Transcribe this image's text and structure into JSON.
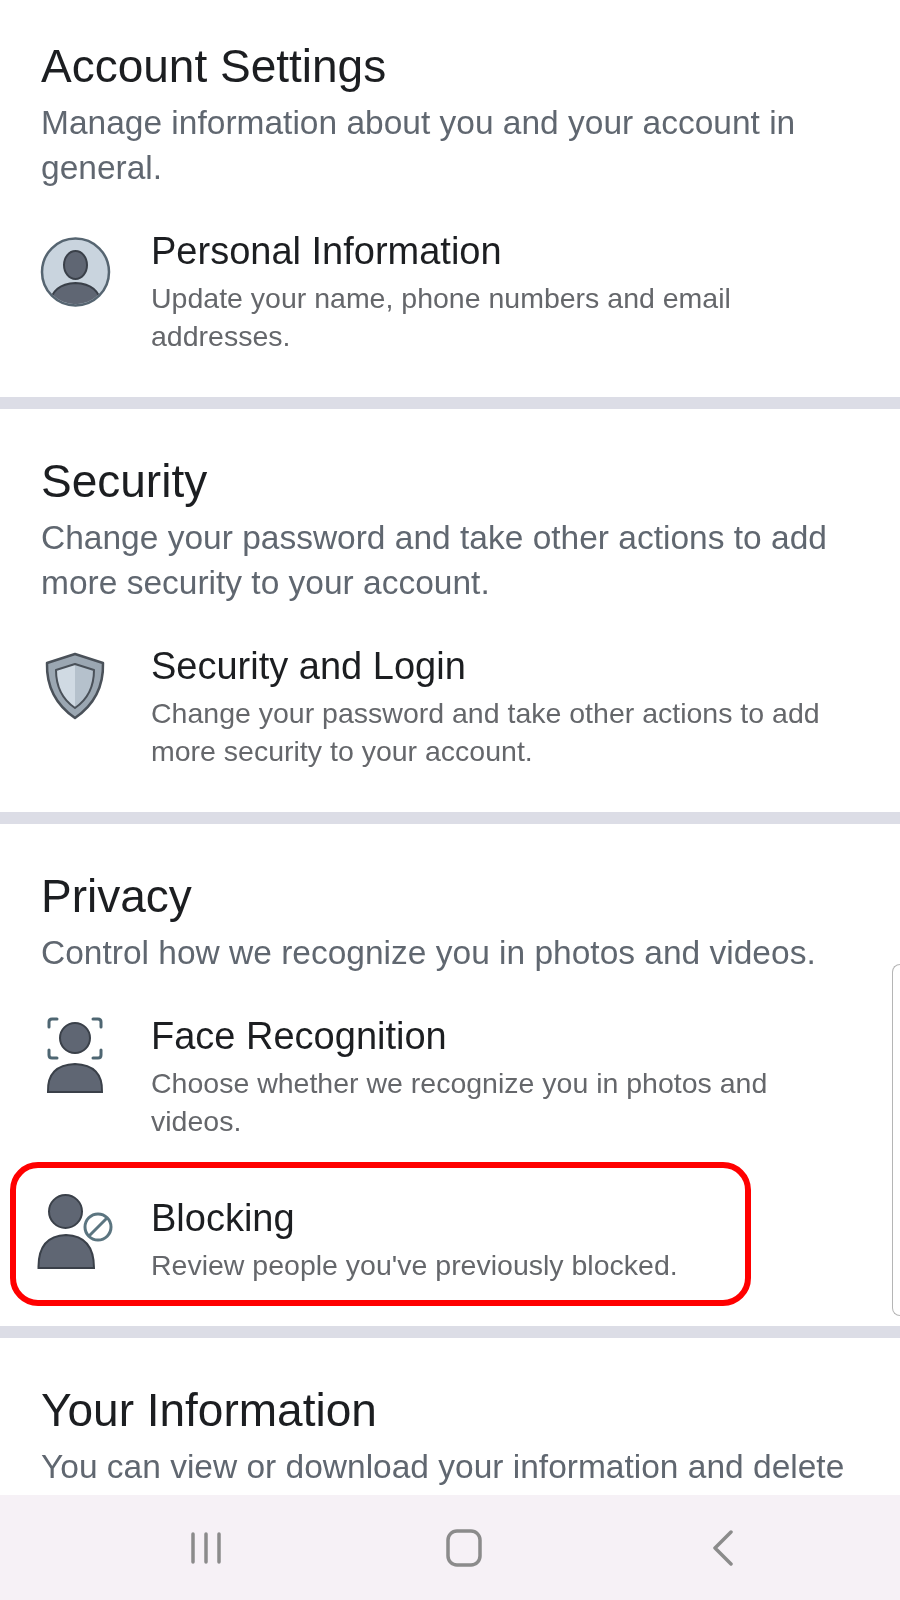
{
  "sections": [
    {
      "title": "Account Settings",
      "description": "Manage information about you and your account in general.",
      "items": [
        {
          "title": "Personal Information",
          "description": "Update your name, phone numbers and email addresses.",
          "highlighted": false
        }
      ]
    },
    {
      "title": "Security",
      "description": "Change your password and take other actions to add more security to your account.",
      "items": [
        {
          "title": "Security and Login",
          "description": "Change your password and take other actions to add more security to your account.",
          "highlighted": false
        }
      ]
    },
    {
      "title": "Privacy",
      "description": "Control how we recognize you in photos and videos.",
      "items": [
        {
          "title": "Face Recognition",
          "description": "Choose whether we recognize you in photos and videos.",
          "highlighted": false
        },
        {
          "title": "Blocking",
          "description": "Review people you've previously blocked.",
          "highlighted": true
        }
      ]
    },
    {
      "title": "Your Information",
      "description": "You can view or download your information and delete"
    }
  ]
}
